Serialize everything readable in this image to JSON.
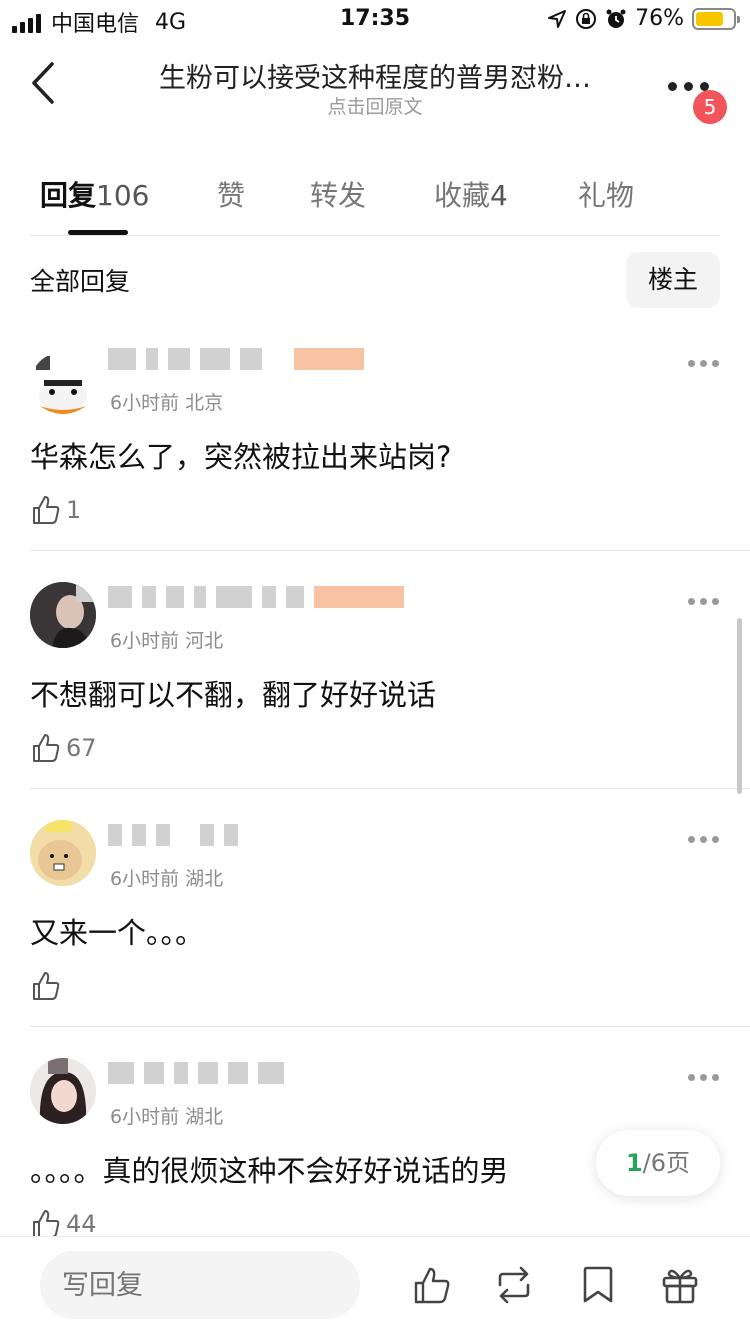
{
  "status_bar": {
    "carrier": "中国电信",
    "network": "4G",
    "time": "17:35",
    "battery": "76%",
    "battery_level": 0.76
  },
  "nav": {
    "title": "生粉可以接受这种程度的普男怼粉…",
    "subtitle": "点击回原文",
    "badge": "5"
  },
  "tabs": [
    {
      "label": "回复",
      "count": "106",
      "active": true
    },
    {
      "label": "赞",
      "count": ""
    },
    {
      "label": "转发",
      "count": ""
    },
    {
      "label": "收藏",
      "count": "4"
    },
    {
      "label": "礼物",
      "count": ""
    }
  ],
  "section": {
    "title": "全部回复",
    "op_label": "楼主"
  },
  "comments": [
    {
      "meta": "6小时前 北京",
      "text": "华森怎么了，突然被拉出来站岗?",
      "likes": "1"
    },
    {
      "meta": "6小时前 河北",
      "text": "不想翻可以不翻，翻了好好说话",
      "likes": "67"
    },
    {
      "meta": "6小时前 湖北",
      "text": "又来一个。。。",
      "likes": ""
    },
    {
      "meta": "6小时前 湖北",
      "text": "。。。。真的很烦这种不会好好说话的男",
      "likes": "44"
    }
  ],
  "pager": {
    "current": "1",
    "total": "/6页"
  },
  "bottom": {
    "reply_placeholder": "写回复"
  },
  "colors": {
    "accent_green": "#27a35a",
    "badge_red": "#f2545b",
    "battery_yellow": "#f7c600"
  }
}
